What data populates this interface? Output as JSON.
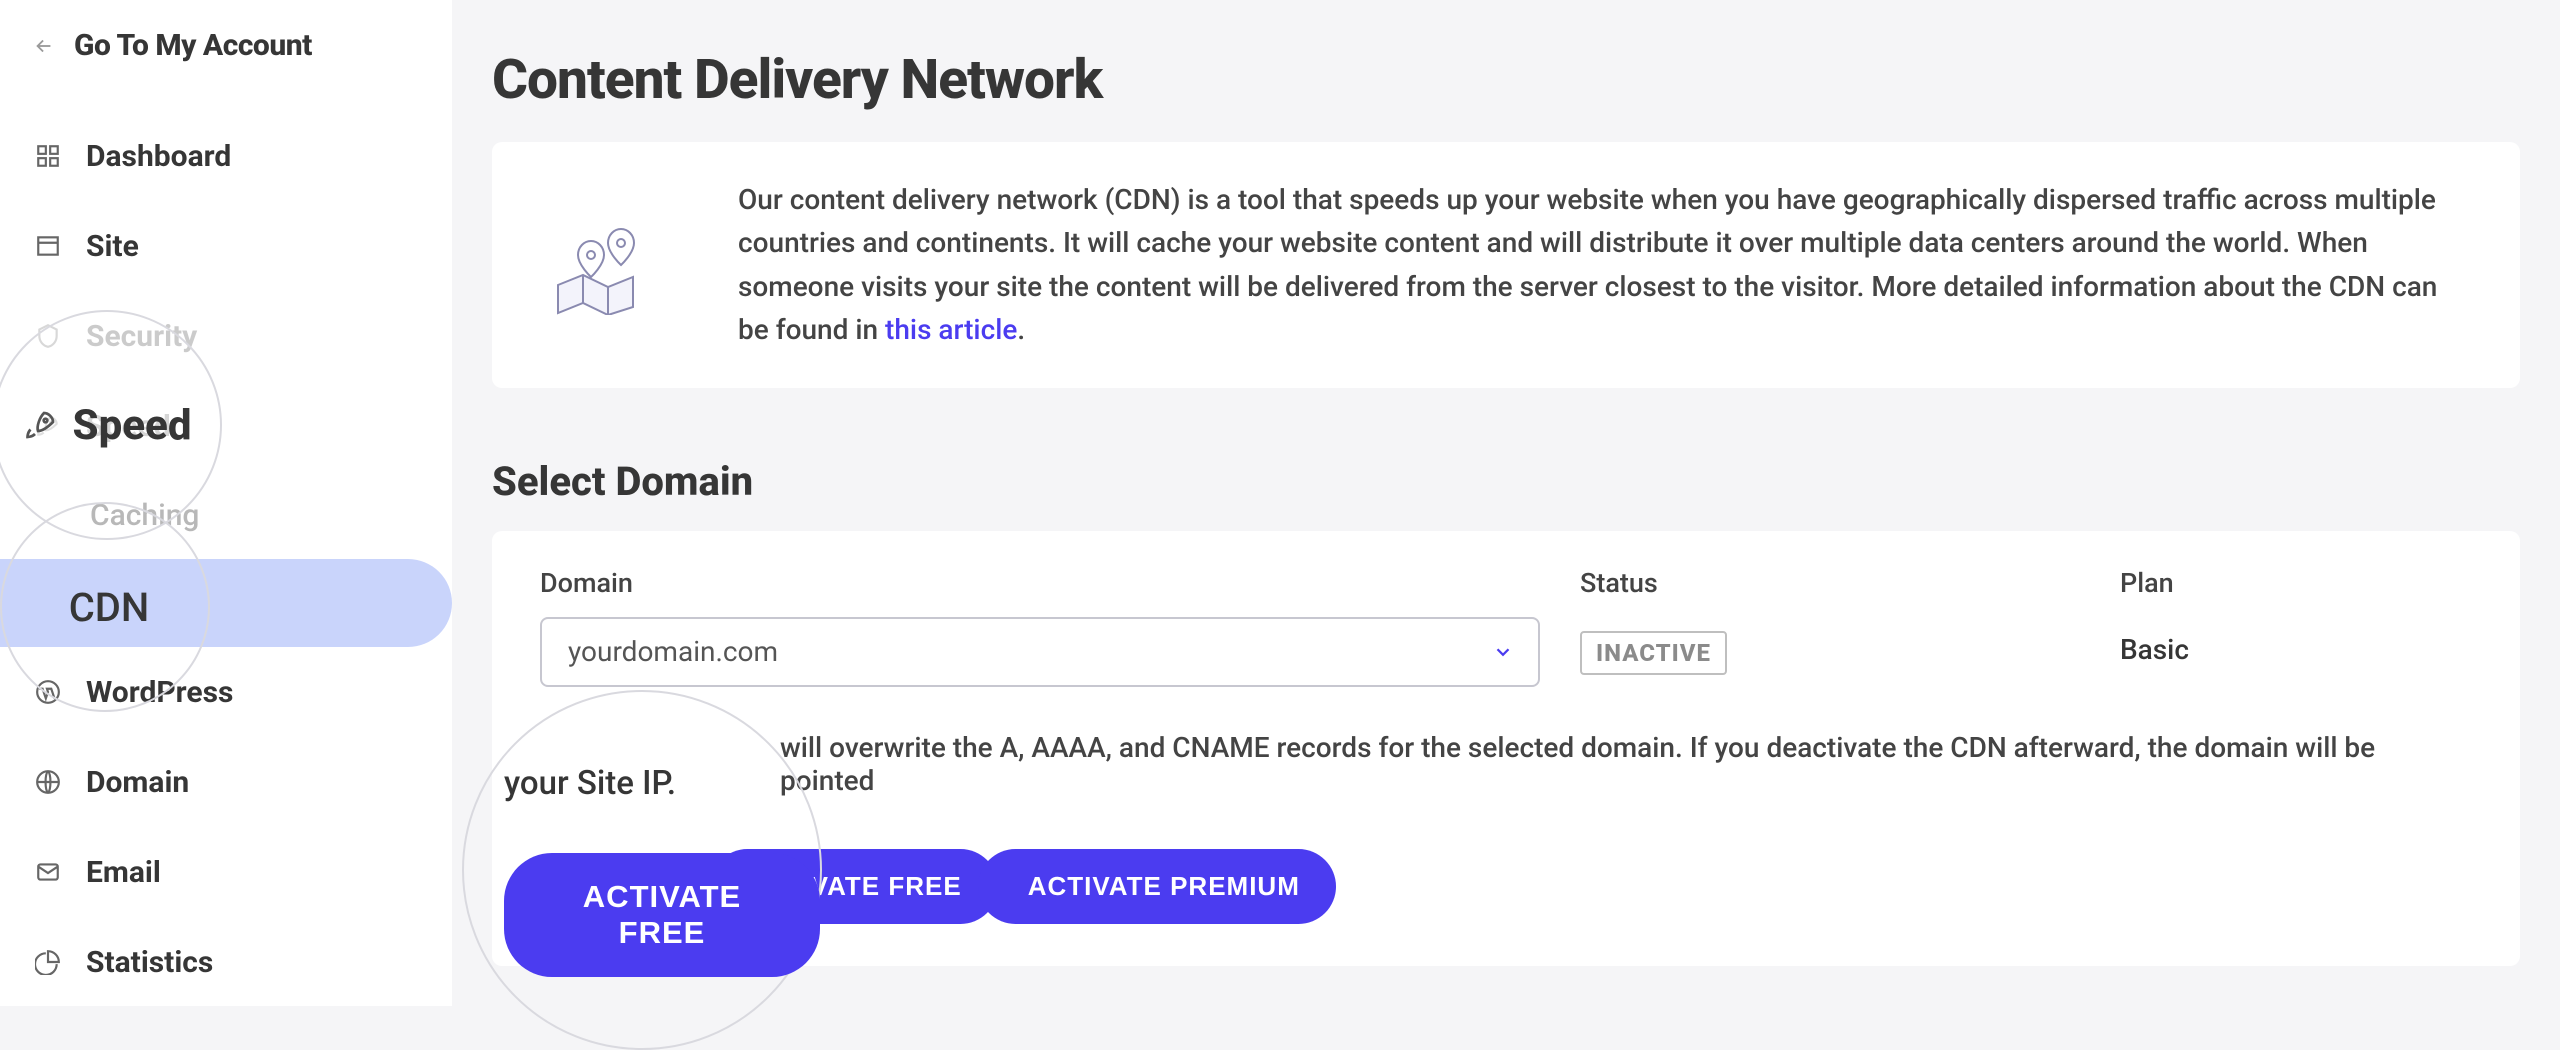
{
  "back_label": "Go To My Account",
  "sidebar": {
    "items": [
      {
        "label": "Dashboard"
      },
      {
        "label": "Site"
      },
      {
        "label": "Security"
      },
      {
        "label": "Speed"
      },
      {
        "label": "WordPress"
      },
      {
        "label": "Domain"
      },
      {
        "label": "Email"
      },
      {
        "label": "Statistics"
      }
    ],
    "speed_sub": [
      {
        "label": "Caching"
      },
      {
        "label": "CDN"
      }
    ]
  },
  "magnifiers": {
    "speed_label": "Speed",
    "cdn_label": "CDN",
    "activate_ip": "your Site IP.",
    "activate_button": "ACTIVATE FREE"
  },
  "page": {
    "title": "Content Delivery Network",
    "intro_text": "Our content delivery network (CDN) is a tool that speeds up your website when you have geographically dispersed traffic across multiple countries and continents. It will cache your website content and will distribute it over multiple data centers around the world. When someone visits your site the content will be delivered from the server closest to the visitor. More detailed information about the CDN can be found in ",
    "intro_link": "this article",
    "intro_tail": ".",
    "section_title": "Select Domain",
    "col_domain": "Domain",
    "col_status": "Status",
    "col_plan": "Plan",
    "domain_value": "yourdomain.com",
    "status_value": "INACTIVE",
    "plan_value": "Basic",
    "note_tail": "will overwrite the A, AAAA, and CNAME records for the selected domain. If you deactivate the CDN afterward, the domain will be pointed",
    "cta_free": "ACTIVATE FREE",
    "cta_premium": "ACTIVATE PREMIUM"
  }
}
